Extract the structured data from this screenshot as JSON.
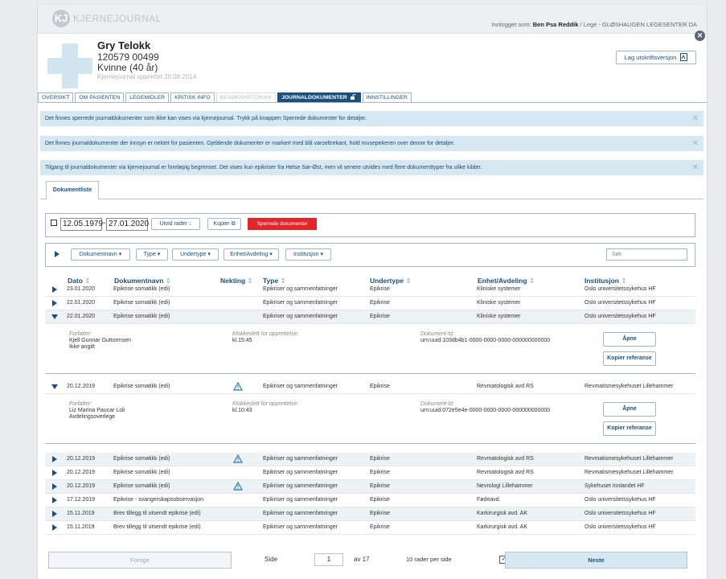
{
  "app": {
    "logo_mark": "KJ",
    "logo": "KJERNEJOURNAL"
  },
  "login": {
    "prefix": "Innlogget som:",
    "user": "Ben Psa Reddik",
    "role": "/ Lege - GLØSHAUGEN LEGESENTER DA"
  },
  "patient": {
    "name": "Gry Telokk",
    "id": "120579 00499",
    "gender_age": "Kvinne (40 år)",
    "created": "Kjernejournal opprettet 20.08.2014"
  },
  "print_button": "Lag utskriftsversjon",
  "tabs": [
    {
      "label": "OVERSIKT"
    },
    {
      "label": "OM PASIENTEN"
    },
    {
      "label": "LEGEMIDLER"
    },
    {
      "label": "KRITISK INFO"
    },
    {
      "label": "BESØKSHISTORIKK"
    },
    {
      "label": "JOURNALDOKUMENTER"
    },
    {
      "label": "INNSTILLINGER"
    }
  ],
  "banners": [
    "Det finnes sperrede journaldokumenter som ikke kan vises via kjernejournal. Trykk på knappen Sperrede dokumenter for detaljer.",
    "Det finnes journaldokumenter der innsyn er nektet for pasienten. Gjeldende dokumenter er markert med blå varseltrekant, hold musepekeren over denne for detaljer.",
    "Tilgang til journaldokumenter via kjernejournal er foreløpig begrenset. Det vises kun epikriser fra Helse Sør-Øst, men vil senere utvides med flere dokumenttyper fra ulike kilder."
  ],
  "doclist_tab": "Dokumentliste",
  "filters": {
    "from_date": "12.05.1979",
    "to_date": "27.01.2020",
    "expand_rows": "Utvid rader",
    "copy": "Kopier",
    "blocked_docs": "Sperrede dokumenter",
    "dropdowns": [
      "Dokumentnavn",
      "Type",
      "Undertype",
      "Enhet/Avdeling",
      "Institusjon"
    ],
    "search_placeholder": "Søk"
  },
  "columns": [
    "Dato",
    "Dokumentnavn",
    "Nekting",
    "Type",
    "Undertype",
    "Enhet/Avdeling",
    "Institusjon"
  ],
  "rows": [
    {
      "date": "23.01.2020",
      "name": "Epikrise somatikk (edi)",
      "type": "Epikriser og sammenfatninger",
      "sub": "Epikrise",
      "unit": "Kliniske systemer",
      "inst": "Oslo universitetssykehus HF"
    },
    {
      "date": "22.01.2020",
      "name": "Epikrise somatikk (edi)",
      "type": "Epikriser og sammenfatninger",
      "sub": "Epikrise",
      "unit": "Kliniske systemer",
      "inst": "Oslo universitetssykehus HF"
    },
    {
      "date": "22.01.2020",
      "name": "Epikrise somatikk (edi)",
      "type": "Epikriser og sammenfatninger",
      "sub": "Epikrise",
      "unit": "Kliniske systemer",
      "inst": "Oslo universitetssykehus HF"
    },
    {
      "date": "20.12.2019",
      "name": "Epikrise somatikk (edi)",
      "type": "Epikriser og sammenfatninger",
      "sub": "Epikrise",
      "unit": "Revmatologisk avd RS",
      "inst": "Revmatismesykehuset Lillehammer"
    },
    {
      "date": "20.12.2019",
      "name": "Epikrise somatikk (edi)",
      "type": "Epikriser og sammenfatninger",
      "sub": "Epikrise",
      "unit": "Revmatologisk avd RS",
      "inst": "Revmatismesykehuset Lillehammer"
    },
    {
      "date": "20.12.2019",
      "name": "Epikrise somatikk (edi)",
      "type": "Epikriser og sammenfatninger",
      "sub": "Epikrise",
      "unit": "Revmatologisk avd RS",
      "inst": "Revmatismesykehuset Lillehammer"
    },
    {
      "date": "20.12.2019",
      "name": "Epikrise somatikk (edi)",
      "type": "Epikriser og sammenfatninger",
      "sub": "Epikrise",
      "unit": "Nevrologi Lillehammer",
      "inst": "Sykehuset Innlandet HF"
    },
    {
      "date": "17.12.2019",
      "name": "Epikrise - svangerskapsobservasjon",
      "type": "Epikriser og sammenfatninger",
      "sub": "Epikrise",
      "unit": "Fødeavd.",
      "inst": "Oslo universitetssykehus HF"
    },
    {
      "date": "15.11.2019",
      "name": "Brev tillegg til utsendt epikrise (edi)",
      "type": "Epikriser og sammenfatninger",
      "sub": "Epikrise",
      "unit": "Karkirurgisk avd. AK",
      "inst": "Oslo universitetssykehus HF"
    },
    {
      "date": "15.11.2019",
      "name": "Brev tillegg til utsendt epikrise (edi)",
      "type": "Epikriser og sammenfatninger",
      "sub": "Epikrise",
      "unit": "Karkirurgisk avd. AK",
      "inst": "Oslo universitetssykehus HF"
    }
  ],
  "details": [
    {
      "author_label": "Forfatter:",
      "author": "Kjell Gunnar Guttormsen",
      "author_role": "Ikke angitt",
      "time_label": "Klokkeslett for opprettelse:",
      "time": "kl.15:45",
      "doc_label": "Dokument-Id:",
      "doc_id": "urn:uuid:103db4b1-0000-0000-0000-000000000000",
      "open": "Åpne",
      "copy_ref": "Kopier referanse"
    },
    {
      "author_label": "Forfatter:",
      "author": "Liz Marina Paucar Loli",
      "author_role": "Avdelingsoverlege",
      "time_label": "Klokkeslett for opprettelse:",
      "time": "kl.10:43",
      "doc_label": "Dokument-Id:",
      "doc_id": "urn:uuid:072e5e4e-0000-0000-0000-000000000000",
      "open": "Åpne",
      "copy_ref": "Kopier referanse"
    }
  ],
  "pager": {
    "prev": "Forrige",
    "page_label": "Side",
    "page": "1",
    "of": "av 17",
    "per_page": "10 rader per side",
    "next": "Neste"
  },
  "colors": {
    "accent": "#1a4f80",
    "banner": "#d6e8f2",
    "danger": "#e2262a",
    "warn_icon": "#2d78b0"
  }
}
